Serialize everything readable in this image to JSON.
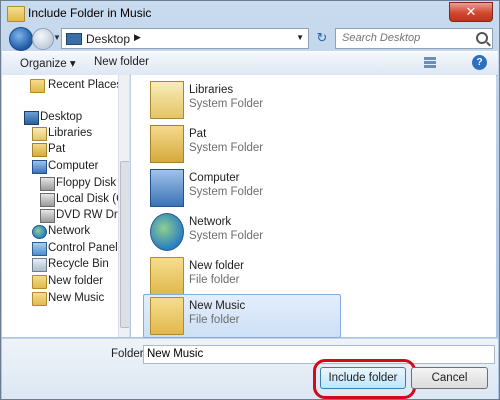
{
  "window": {
    "title": "Include Folder in Music",
    "close_glyph": "✕"
  },
  "nav": {
    "breadcrumb": "Desktop",
    "breadcrumb_arrow": "▶",
    "dropdown_glyph": "▼",
    "refresh_glyph": "↻",
    "search_placeholder": "Search Desktop"
  },
  "toolbar": {
    "organize": "Organize ▾",
    "new_folder": "New folder",
    "help_glyph": "?"
  },
  "sidebar": {
    "items": [
      {
        "label": "Recent Places",
        "icon": "recent-places-icon"
      },
      {
        "label": "Desktop",
        "icon": "desktop-icon"
      },
      {
        "label": "Libraries",
        "icon": "libraries-icon"
      },
      {
        "label": "Pat",
        "icon": "user-folder-icon"
      },
      {
        "label": "Computer",
        "icon": "computer-icon"
      },
      {
        "label": "Floppy Disk Dri",
        "icon": "floppy-drive-icon"
      },
      {
        "label": "Local Disk (C:)",
        "icon": "hard-disk-icon"
      },
      {
        "label": "DVD RW Drive (",
        "icon": "dvd-drive-icon"
      },
      {
        "label": "Network",
        "icon": "network-icon"
      },
      {
        "label": "Control Panel",
        "icon": "control-panel-icon"
      },
      {
        "label": "Recycle Bin",
        "icon": "recycle-bin-icon"
      },
      {
        "label": "New folder",
        "icon": "folder-icon"
      },
      {
        "label": "New Music",
        "icon": "folder-icon"
      }
    ]
  },
  "content": {
    "items": [
      {
        "name": "Libraries",
        "type": "System Folder",
        "icon": "libraries-icon"
      },
      {
        "name": "Pat",
        "type": "System Folder",
        "icon": "user-folder-icon"
      },
      {
        "name": "Computer",
        "type": "System Folder",
        "icon": "computer-icon"
      },
      {
        "name": "Network",
        "type": "System Folder",
        "icon": "network-icon"
      },
      {
        "name": "New folder",
        "type": "File folder",
        "icon": "folder-icon"
      },
      {
        "name": "New Music",
        "type": "File folder",
        "icon": "folder-icon",
        "selected": true
      }
    ]
  },
  "footer": {
    "folder_label": "Folder:",
    "folder_value": "New Music",
    "include_button": "Include folder",
    "cancel_button": "Cancel"
  },
  "colors": {
    "highlight_ring": "#d10a1c",
    "selection": "#cde0f7"
  }
}
